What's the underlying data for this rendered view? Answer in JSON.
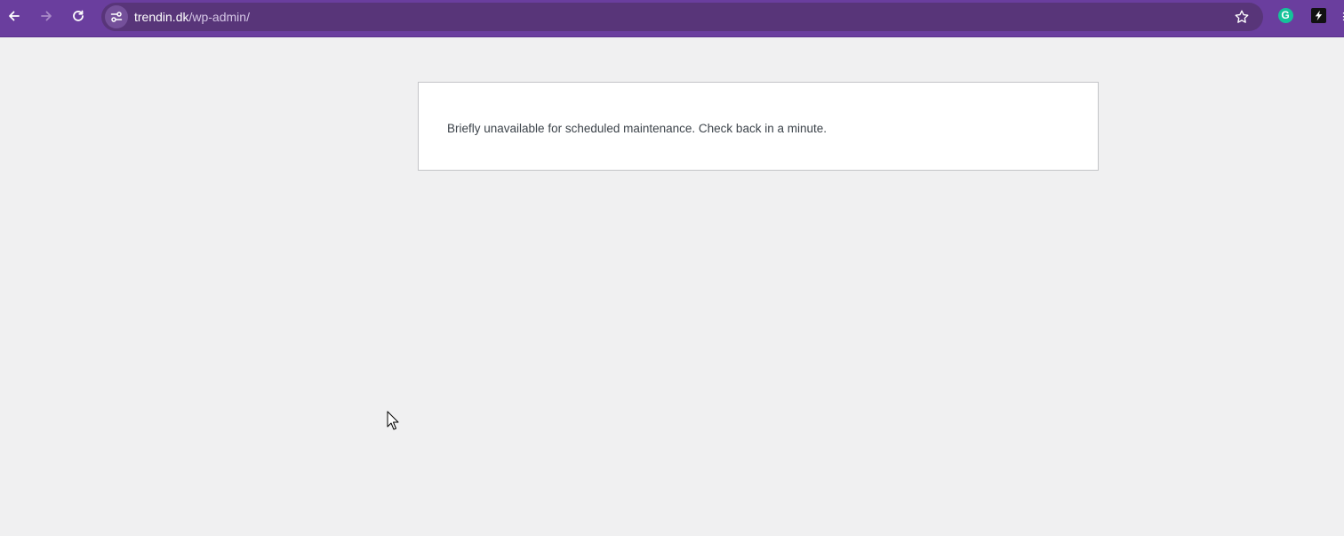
{
  "browser": {
    "url_host": "trendin.dk",
    "url_path": "/wp-admin/",
    "icons": {
      "back": "back-arrow-icon",
      "forward": "forward-arrow-icon",
      "reload": "reload-icon",
      "site_info": "site-settings-icon",
      "bookmark": "star-icon",
      "grammarly": "grammarly-icon",
      "extension": "lightning-extension-icon"
    },
    "grammarly_letter": "G",
    "toolbar_color": "#6a3e9e"
  },
  "page": {
    "message": "Briefly unavailable for scheduled maintenance. Check back in a minute.",
    "background_color": "#f0f0f1"
  }
}
